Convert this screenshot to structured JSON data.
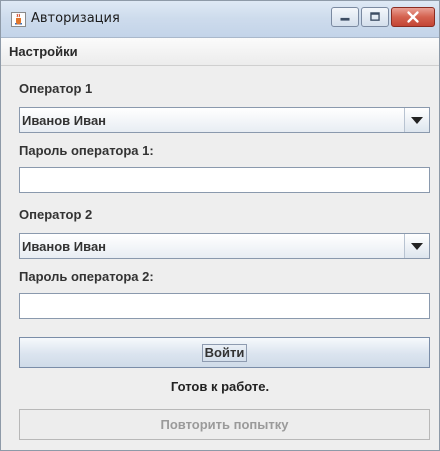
{
  "window": {
    "title": "Авторизация",
    "icon": "java-cup-icon",
    "controls": [
      "minimize-icon",
      "maximize-icon",
      "close-icon"
    ],
    "close_color": "#c9503f"
  },
  "menubar": {
    "items": [
      {
        "label": "Настройки"
      }
    ]
  },
  "form": {
    "operator1": {
      "label": "Оператор 1",
      "selected": "Иванов Иван",
      "password_label": "Пароль оператора 1:",
      "password_value": ""
    },
    "operator2": {
      "label": "Оператор 2",
      "selected": "Иванов Иван",
      "password_label": "Пароль оператора 2:",
      "password_value": ""
    },
    "login_label": "Войти",
    "status_text": "Готов к работе.",
    "retry_label": "Повторить попытку"
  }
}
